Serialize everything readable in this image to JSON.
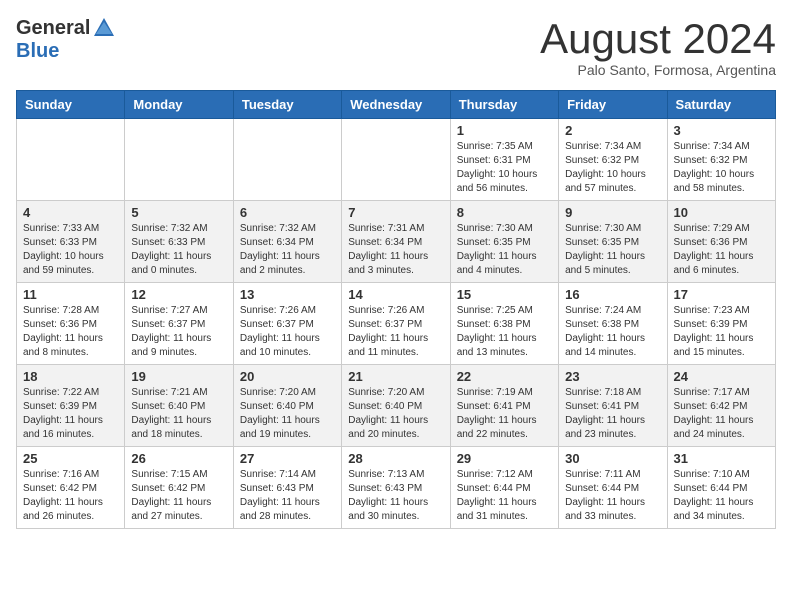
{
  "header": {
    "logo_general": "General",
    "logo_blue": "Blue",
    "month_title": "August 2024",
    "subtitle": "Palo Santo, Formosa, Argentina"
  },
  "days_of_week": [
    "Sunday",
    "Monday",
    "Tuesday",
    "Wednesday",
    "Thursday",
    "Friday",
    "Saturday"
  ],
  "weeks": [
    [
      {
        "day": "",
        "info": ""
      },
      {
        "day": "",
        "info": ""
      },
      {
        "day": "",
        "info": ""
      },
      {
        "day": "",
        "info": ""
      },
      {
        "day": "1",
        "info": "Sunrise: 7:35 AM\nSunset: 6:31 PM\nDaylight: 10 hours and 56 minutes."
      },
      {
        "day": "2",
        "info": "Sunrise: 7:34 AM\nSunset: 6:32 PM\nDaylight: 10 hours and 57 minutes."
      },
      {
        "day": "3",
        "info": "Sunrise: 7:34 AM\nSunset: 6:32 PM\nDaylight: 10 hours and 58 minutes."
      }
    ],
    [
      {
        "day": "4",
        "info": "Sunrise: 7:33 AM\nSunset: 6:33 PM\nDaylight: 10 hours and 59 minutes."
      },
      {
        "day": "5",
        "info": "Sunrise: 7:32 AM\nSunset: 6:33 PM\nDaylight: 11 hours and 0 minutes."
      },
      {
        "day": "6",
        "info": "Sunrise: 7:32 AM\nSunset: 6:34 PM\nDaylight: 11 hours and 2 minutes."
      },
      {
        "day": "7",
        "info": "Sunrise: 7:31 AM\nSunset: 6:34 PM\nDaylight: 11 hours and 3 minutes."
      },
      {
        "day": "8",
        "info": "Sunrise: 7:30 AM\nSunset: 6:35 PM\nDaylight: 11 hours and 4 minutes."
      },
      {
        "day": "9",
        "info": "Sunrise: 7:30 AM\nSunset: 6:35 PM\nDaylight: 11 hours and 5 minutes."
      },
      {
        "day": "10",
        "info": "Sunrise: 7:29 AM\nSunset: 6:36 PM\nDaylight: 11 hours and 6 minutes."
      }
    ],
    [
      {
        "day": "11",
        "info": "Sunrise: 7:28 AM\nSunset: 6:36 PM\nDaylight: 11 hours and 8 minutes."
      },
      {
        "day": "12",
        "info": "Sunrise: 7:27 AM\nSunset: 6:37 PM\nDaylight: 11 hours and 9 minutes."
      },
      {
        "day": "13",
        "info": "Sunrise: 7:26 AM\nSunset: 6:37 PM\nDaylight: 11 hours and 10 minutes."
      },
      {
        "day": "14",
        "info": "Sunrise: 7:26 AM\nSunset: 6:37 PM\nDaylight: 11 hours and 11 minutes."
      },
      {
        "day": "15",
        "info": "Sunrise: 7:25 AM\nSunset: 6:38 PM\nDaylight: 11 hours and 13 minutes."
      },
      {
        "day": "16",
        "info": "Sunrise: 7:24 AM\nSunset: 6:38 PM\nDaylight: 11 hours and 14 minutes."
      },
      {
        "day": "17",
        "info": "Sunrise: 7:23 AM\nSunset: 6:39 PM\nDaylight: 11 hours and 15 minutes."
      }
    ],
    [
      {
        "day": "18",
        "info": "Sunrise: 7:22 AM\nSunset: 6:39 PM\nDaylight: 11 hours and 16 minutes."
      },
      {
        "day": "19",
        "info": "Sunrise: 7:21 AM\nSunset: 6:40 PM\nDaylight: 11 hours and 18 minutes."
      },
      {
        "day": "20",
        "info": "Sunrise: 7:20 AM\nSunset: 6:40 PM\nDaylight: 11 hours and 19 minutes."
      },
      {
        "day": "21",
        "info": "Sunrise: 7:20 AM\nSunset: 6:40 PM\nDaylight: 11 hours and 20 minutes."
      },
      {
        "day": "22",
        "info": "Sunrise: 7:19 AM\nSunset: 6:41 PM\nDaylight: 11 hours and 22 minutes."
      },
      {
        "day": "23",
        "info": "Sunrise: 7:18 AM\nSunset: 6:41 PM\nDaylight: 11 hours and 23 minutes."
      },
      {
        "day": "24",
        "info": "Sunrise: 7:17 AM\nSunset: 6:42 PM\nDaylight: 11 hours and 24 minutes."
      }
    ],
    [
      {
        "day": "25",
        "info": "Sunrise: 7:16 AM\nSunset: 6:42 PM\nDaylight: 11 hours and 26 minutes."
      },
      {
        "day": "26",
        "info": "Sunrise: 7:15 AM\nSunset: 6:42 PM\nDaylight: 11 hours and 27 minutes."
      },
      {
        "day": "27",
        "info": "Sunrise: 7:14 AM\nSunset: 6:43 PM\nDaylight: 11 hours and 28 minutes."
      },
      {
        "day": "28",
        "info": "Sunrise: 7:13 AM\nSunset: 6:43 PM\nDaylight: 11 hours and 30 minutes."
      },
      {
        "day": "29",
        "info": "Sunrise: 7:12 AM\nSunset: 6:44 PM\nDaylight: 11 hours and 31 minutes."
      },
      {
        "day": "30",
        "info": "Sunrise: 7:11 AM\nSunset: 6:44 PM\nDaylight: 11 hours and 33 minutes."
      },
      {
        "day": "31",
        "info": "Sunrise: 7:10 AM\nSunset: 6:44 PM\nDaylight: 11 hours and 34 minutes."
      }
    ]
  ]
}
